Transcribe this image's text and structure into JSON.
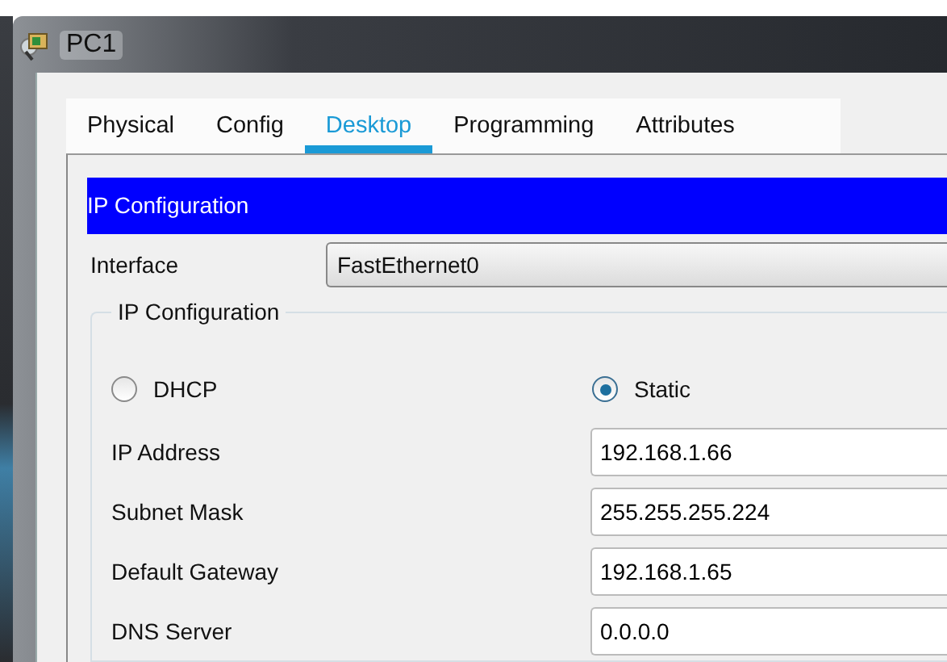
{
  "window": {
    "title": "PC1"
  },
  "tabs": [
    {
      "label": "Physical",
      "selected": false
    },
    {
      "label": "Config",
      "selected": false
    },
    {
      "label": "Desktop",
      "selected": true
    },
    {
      "label": "Programming",
      "selected": false
    },
    {
      "label": "Attributes",
      "selected": false
    }
  ],
  "panel_title": "IP Configuration",
  "interface": {
    "label": "Interface",
    "value": "FastEthernet0"
  },
  "group": {
    "title": "IP Configuration",
    "modes": [
      {
        "label": "DHCP",
        "selected": false
      },
      {
        "label": "Static",
        "selected": true
      }
    ],
    "fields": [
      {
        "label": "IP Address",
        "value": "192.168.1.66"
      },
      {
        "label": "Subnet Mask",
        "value": "255.255.255.224"
      },
      {
        "label": "Default Gateway",
        "value": "192.168.1.65"
      },
      {
        "label": "DNS Server",
        "value": "0.0.0.0"
      }
    ]
  }
}
